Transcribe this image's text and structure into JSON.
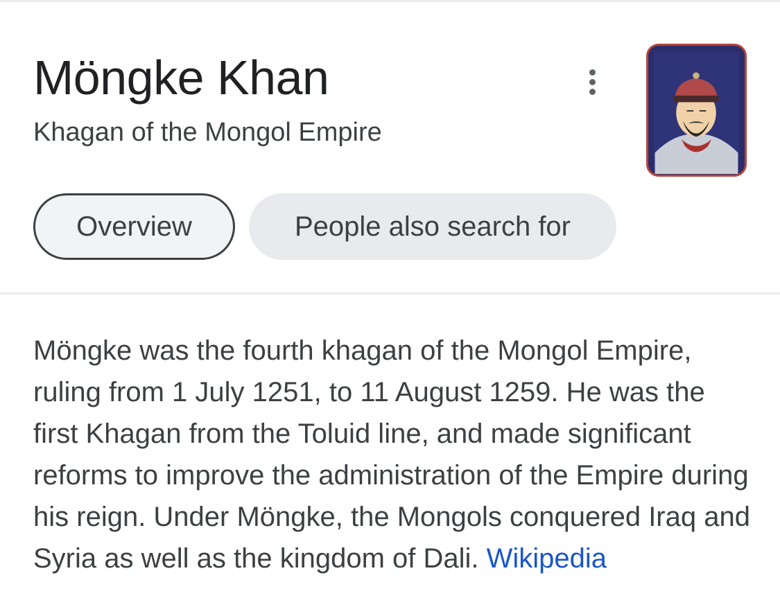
{
  "entity": {
    "title": "Möngke Khan",
    "subtitle": "Khagan of the Mongol Empire",
    "image_alt": "portrait"
  },
  "tabs": [
    {
      "label": "Overview",
      "active": true
    },
    {
      "label": "People also search for",
      "active": false
    }
  ],
  "description": {
    "text": "Möngke was the fourth khagan of the Mongol Empire, ruling from 1 July 1251, to 11 August 1259. He was the first Khagan from the Toluid line, and made significant reforms to improve the administration of the Empire during his reign. Under Möngke, the Mongols conquered Iraq and Syria as well as the kingdom of Dali. ",
    "source_link": "Wikipedia"
  },
  "icons": {
    "more": "more-vert-icon"
  },
  "colors": {
    "link": "#1a57c7",
    "chip_bg": "#e8eaed",
    "text": "#3c4043"
  }
}
